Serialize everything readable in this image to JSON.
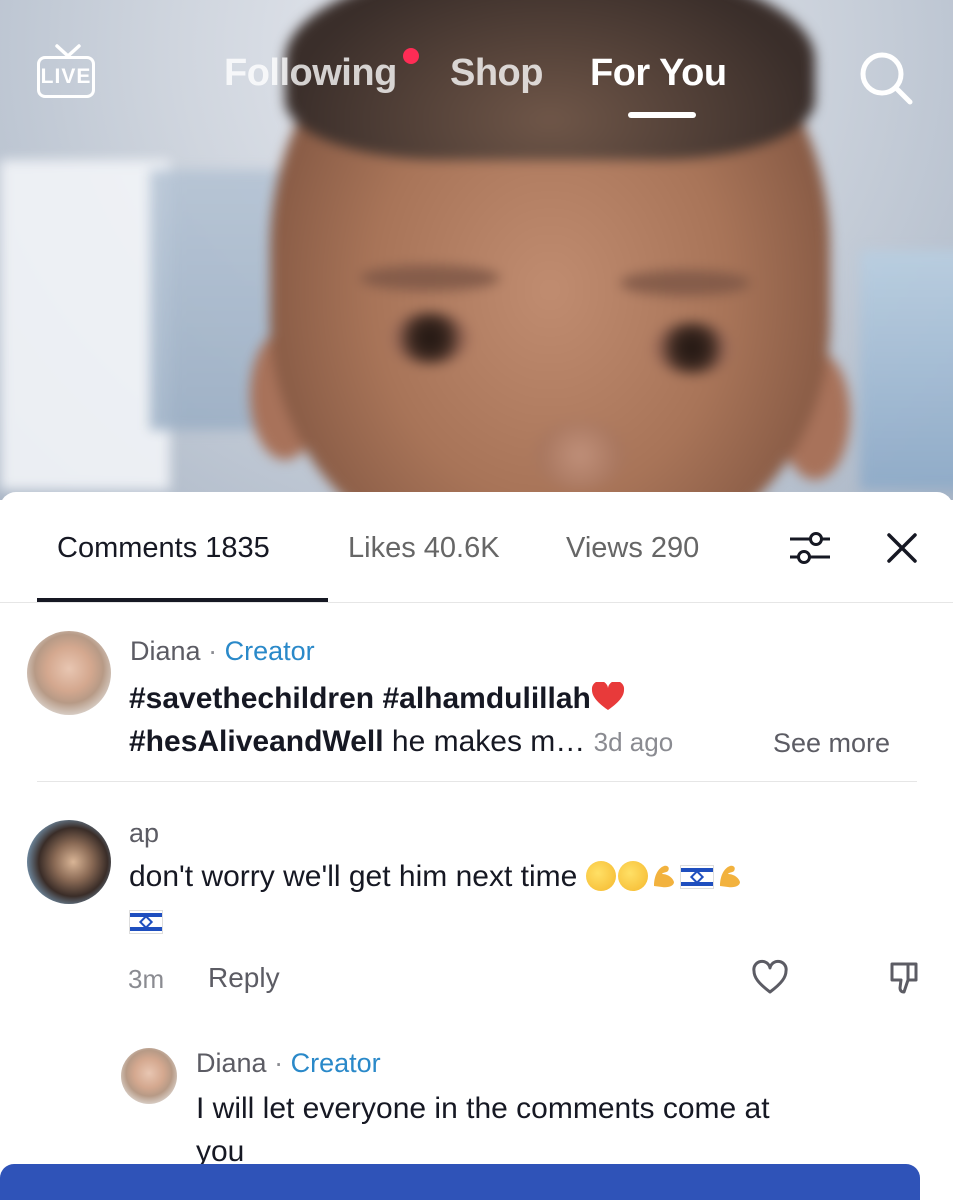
{
  "top_nav": {
    "live_label": "LIVE",
    "tabs": [
      {
        "label": "Following",
        "has_notification_dot": true
      },
      {
        "label": "Shop"
      },
      {
        "label": "For You",
        "active": true
      }
    ],
    "search_icon": "search-icon"
  },
  "comments_sheet": {
    "tabs": {
      "comments": "Comments 1835",
      "likes": "Likes 40.6K",
      "views": "Views 290"
    },
    "filter_icon": "sliders-icon",
    "close_icon": "close-icon",
    "pinned_comment": {
      "author": "Diana",
      "separator": "·",
      "badge": "Creator",
      "line1": "#savethechildren #alhamdulillah",
      "line2_tag": "#hesAliveandWell",
      "line2_text": " he makes m…",
      "time": "3d ago",
      "see_more": "See more"
    },
    "comment": {
      "author": "ap",
      "text": "don't worry we'll get him next time ",
      "time": "3m",
      "reply_label": "Reply"
    },
    "reply": {
      "author": "Diana",
      "separator": "·",
      "badge": "Creator",
      "line1": "I will let everyone in the comments come at",
      "line2": "you"
    }
  },
  "colors": {
    "accent_red": "#fe2c55",
    "creator_blue": "#2a89c9",
    "banner_blue": "#2f53b8"
  }
}
